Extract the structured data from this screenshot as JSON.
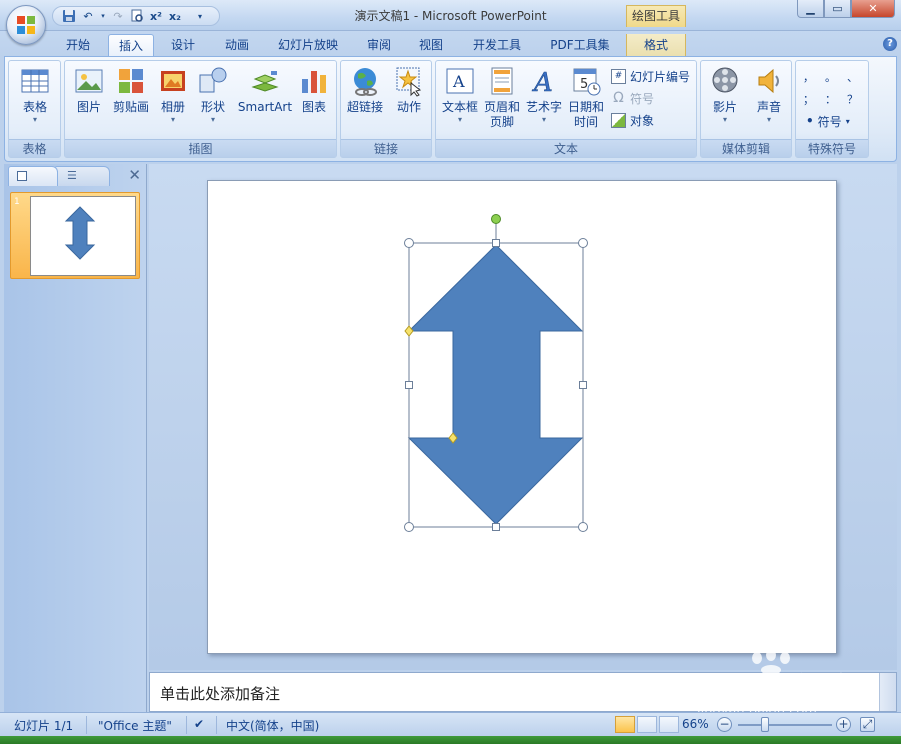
{
  "app": {
    "window_title": "演示文稿1 - Microsoft PowerPoint",
    "context_tab_label": "绘图工具"
  },
  "tabs": [
    {
      "label": "开始"
    },
    {
      "label": "插入"
    },
    {
      "label": "设计"
    },
    {
      "label": "动画"
    },
    {
      "label": "幻灯片放映"
    },
    {
      "label": "审阅"
    },
    {
      "label": "视图"
    },
    {
      "label": "开发工具"
    },
    {
      "label": "PDF工具集"
    },
    {
      "label": "格式"
    }
  ],
  "active_tab": "插入",
  "ribbon": {
    "groups": {
      "table": {
        "label": "表格",
        "table_btn": "表格"
      },
      "illustrations": {
        "label": "插图",
        "picture": "图片",
        "clipart": "剪贴画",
        "album": "相册",
        "shapes": "形状",
        "smartart": "SmartArt",
        "chart": "图表"
      },
      "links": {
        "label": "链接",
        "hyperlink": "超链接",
        "action": "动作"
      },
      "text": {
        "label": "文本",
        "textbox": "文本框",
        "header_footer_1": "页眉和",
        "header_footer_2": "页脚",
        "wordart": "艺术字",
        "datetime_1": "日期和",
        "datetime_2": "时间",
        "slide_number": "幻灯片编号",
        "symbol": "符号",
        "object": "对象"
      },
      "media": {
        "label": "媒体剪辑",
        "movie": "影片",
        "sound": "声音"
      },
      "special": {
        "label": "特殊符号",
        "symbol_btn": "符号",
        "chars": [
          "，",
          "。",
          "、",
          "；",
          "：",
          "？"
        ]
      }
    }
  },
  "slides_pane": {
    "slide_number": "1"
  },
  "notes": {
    "placeholder": "单击此处添加备注"
  },
  "statusbar": {
    "slide_info": "幻灯片 1/1",
    "theme": "\"Office 主题\"",
    "language": "中文(简体，中国)",
    "zoom": "66%"
  },
  "watermark": {
    "logo": "Bai du 经验",
    "url": "jingyan.baidu.com"
  },
  "colors": {
    "shape_fill": "#4f81bd",
    "shape_stroke": "#3a679e",
    "accent": "#15428b"
  }
}
